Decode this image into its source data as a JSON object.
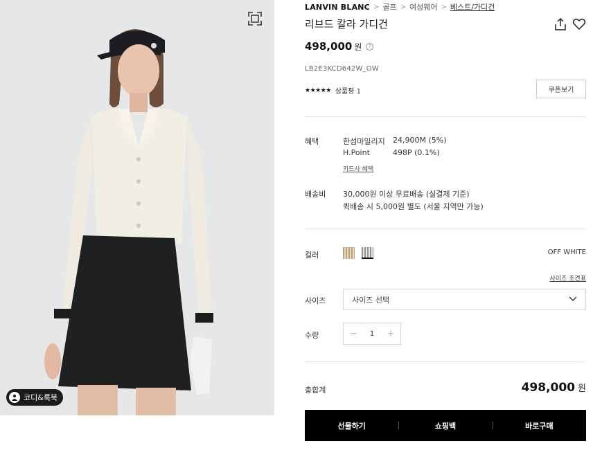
{
  "breadcrumb": {
    "brand": "LANVIN BLANC",
    "items": [
      "골프",
      "여성웨어",
      "베스트/가디건"
    ]
  },
  "product": {
    "title": "리브드 칼라 가디건",
    "price": "498,000",
    "price_unit": "원",
    "sku": "LB2E3KCD642W_OW",
    "stars": "★★★★★",
    "review_label": "상품평 1",
    "coupon_label": "쿠폰보기"
  },
  "benefits": {
    "label": "혜택",
    "rows": [
      {
        "name": "한섬마일리지",
        "value": "24,900M (5%)"
      },
      {
        "name": "H.Point",
        "value": "498P (0.1%)"
      }
    ],
    "card_link": "카드사 혜택"
  },
  "shipping": {
    "label": "배송비",
    "lines": [
      "30,000원 이상 무료배송 (실결제 기준)",
      "퀵배송 시 5,000원 별도 (서울 지역만 가능)"
    ]
  },
  "color": {
    "label": "컬러",
    "selected": "OFF WHITE",
    "swatches": [
      "#c8b48e",
      "#d9dbd5"
    ]
  },
  "size": {
    "chart_link": "사이즈 조견표",
    "label": "사이즈",
    "placeholder": "사이즈 선택"
  },
  "quantity": {
    "label": "수량",
    "value": "1",
    "minus": "−",
    "plus": "+"
  },
  "total": {
    "label": "총합계",
    "value": "498,000",
    "unit": "원"
  },
  "actions": [
    "선물하기",
    "쇼핑백",
    "바로구매"
  ],
  "image": {
    "badge_label": "코디&룩북"
  }
}
